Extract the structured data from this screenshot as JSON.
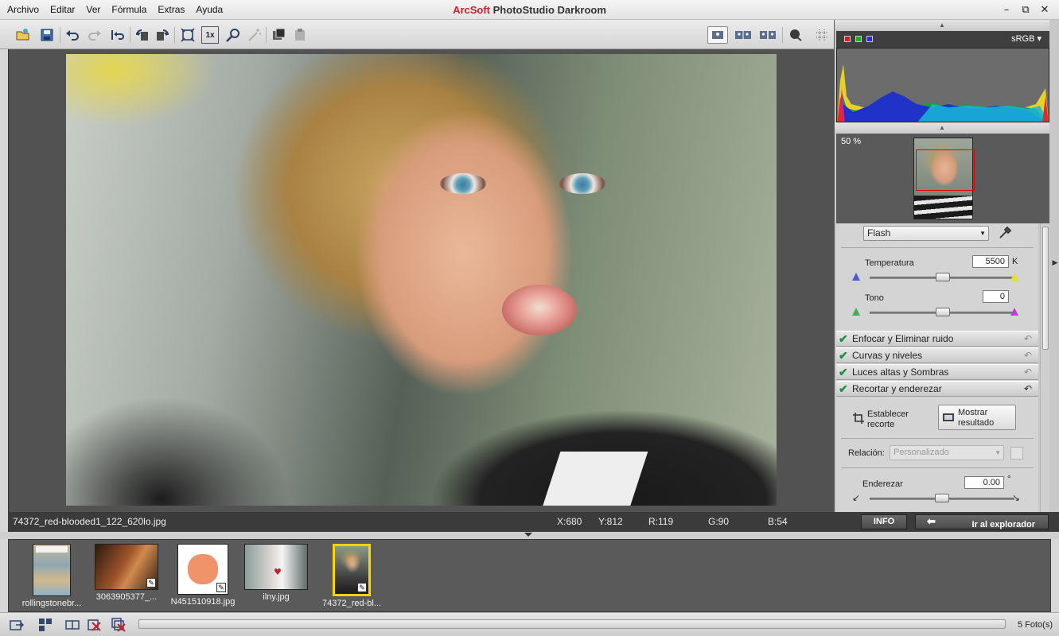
{
  "menu": [
    "Archivo",
    "Editar",
    "Ver",
    "Fórmula",
    "Extras",
    "Ayuda"
  ],
  "title": {
    "brand": "ArcSoft",
    "product": "PhotoStudio Darkroom"
  },
  "window_controls": {
    "minimize": "–",
    "restore": "⧉",
    "close": "✕"
  },
  "toolbar": {
    "icons": [
      "open-folder-icon",
      "save-icon",
      "undo-icon",
      "redo-icon",
      "revert-icon",
      "rotate-left-icon",
      "rotate-right-icon",
      "fit-screen-icon",
      "actual-size-icon",
      "zoom-icon",
      "magic-wand-icon",
      "copy-settings-icon",
      "paste-settings-icon"
    ],
    "actual_size_label": "1x",
    "view_modes": [
      "single-view-icon",
      "split-view-icon",
      "side-by-side-view-icon"
    ],
    "right_icons": [
      "mask-icon",
      "grid-icon"
    ]
  },
  "status": {
    "filename": "74372_red-blooded1_122_620lo.jpg",
    "x": "X:680",
    "y": "Y:812",
    "r": "R:119",
    "g": "G:90",
    "b": "B:54",
    "info_button": "INFO",
    "explorer_button": "Ir al explorador"
  },
  "filmstrip": {
    "thumbs": [
      {
        "label": "rollingstonebr..."
      },
      {
        "label": "3063905377_..."
      },
      {
        "label": "N451510918.jpg"
      },
      {
        "label": "ilny.jpg"
      },
      {
        "label": "74372_red-bl..."
      }
    ],
    "count": "5 Foto(s)"
  },
  "panel": {
    "color_space": "sRGB",
    "swatch_colors": [
      "#d02020",
      "#20b020",
      "#2030e0"
    ],
    "zoom": "50 %",
    "white_balance": "Flash",
    "temperature_label": "Temperatura",
    "temperature_value": "5500",
    "temperature_unit": "K",
    "temperature_level": 0.5,
    "tone_label": "Tono",
    "tone_value": "0",
    "tone_level": 0.5,
    "sections": [
      "Enfocar y Eliminar ruido",
      "Curvas y niveles",
      "Luces altas y Sombras",
      "Recortar y enderezar"
    ],
    "crop": {
      "set_label_1": "Establecer",
      "set_label_2": "recorte",
      "show_label_1": "Mostrar",
      "show_label_2": "resultado",
      "ratio_label": "Relación:",
      "ratio_value": "Personalizado",
      "straighten_label": "Enderezar",
      "straighten_value": "0.00",
      "straighten_unit": "°",
      "straighten_level": 0.5
    }
  }
}
